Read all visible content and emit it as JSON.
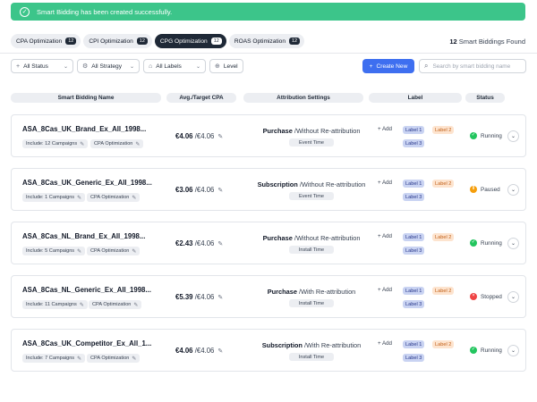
{
  "toast": {
    "message": "Smart Bidding has been created successfully.",
    "icon": "check-circle-icon",
    "color": "#3cc58a"
  },
  "tabs": [
    {
      "label": "CPA Optimization",
      "count": "12",
      "active": false
    },
    {
      "label": "CPI Optimization",
      "count": "12",
      "active": false
    },
    {
      "label": "CPG Optimization",
      "count": "12",
      "active": true
    },
    {
      "label": "ROAS Optimization",
      "count": "12",
      "active": false
    }
  ],
  "found": {
    "count": "12",
    "label": "Smart Biddings Found"
  },
  "filters": {
    "status": "All Status",
    "strategy": "All Strategy",
    "labels": "All Labels",
    "level": "Level"
  },
  "actions": {
    "create_label": "Create New",
    "search_placeholder": "Search by smart bidding name",
    "create_color": "#3e6ff0"
  },
  "columns": {
    "name": "Smart Bidding Name",
    "cpa": "Avg./Target CPA",
    "attribution": "Attribution Settings",
    "label": "Label",
    "status": "Status"
  },
  "rows": [
    {
      "name": "ASA_8Cas_UK_Brand_Ex_All_1998...",
      "include": "Include: 12 Campaigns",
      "opt": "CPA Optimization",
      "avg": "€4.06",
      "target": "/€4.06",
      "event": "Purchase",
      "reattr": "/Without Re-attribution",
      "type": "Event Time",
      "add": "+ Add",
      "label1": "Label 1",
      "label2": "Label 2",
      "label3": "Label 3",
      "status": "Running",
      "status_color": "#22c55e",
      "status_icon": "✓"
    },
    {
      "name": "ASA_8Cas_UK_Generic_Ex_All_1998...",
      "include": "Include: 1 Campaigns",
      "opt": "CPA Optimization",
      "avg": "€3.06",
      "target": "/€4.06",
      "event": "Subscription",
      "reattr": "/Without Re-attribution",
      "type": "Event Time",
      "add": "+ Add",
      "label1": "Label 1",
      "label2": "Label 2",
      "label3": "Label 3",
      "status": "Paused",
      "status_color": "#f59e0b",
      "status_icon": "Ⅱ"
    },
    {
      "name": "ASA_8Cas_NL_Brand_Ex_All_1998...",
      "include": "Include: 5 Campaigns",
      "opt": "CPA Optimization",
      "avg": "€2.43",
      "target": "/€4.06",
      "event": "Purchase",
      "reattr": "/Without Re-attribution",
      "type": "Install Time",
      "add": "+ Add",
      "label1": "Label 1",
      "label2": "Label 2",
      "label3": "Label 3",
      "status": "Running",
      "status_color": "#22c55e",
      "status_icon": "✓"
    },
    {
      "name": "ASA_8Cas_NL_Generic_Ex_All_1998...",
      "include": "Include: 11 Campaigns",
      "opt": "CPA Optimization",
      "avg": "€5.39",
      "target": "/€4.06",
      "event": "Purchase",
      "reattr": "/With Re-attribution",
      "type": "Install Time",
      "add": "+ Add",
      "label1": "Label 1",
      "label2": "Label 2",
      "label3": "Label 3",
      "status": "Stopped",
      "status_color": "#ef4444",
      "status_icon": "×"
    },
    {
      "name": "ASA_8Cas_UK_Competitor_Ex_All_1...",
      "include": "Include: 7 Campaigns",
      "opt": "CPA Optimization",
      "avg": "€4.06",
      "target": "/€4.06",
      "event": "Subscription",
      "reattr": "/With Re-attribution",
      "type": "Install Time",
      "add": "+ Add",
      "label1": "Label 1",
      "label2": "Label 2",
      "label3": "Label 3",
      "status": "Running",
      "status_color": "#22c55e",
      "status_icon": "✓"
    }
  ]
}
